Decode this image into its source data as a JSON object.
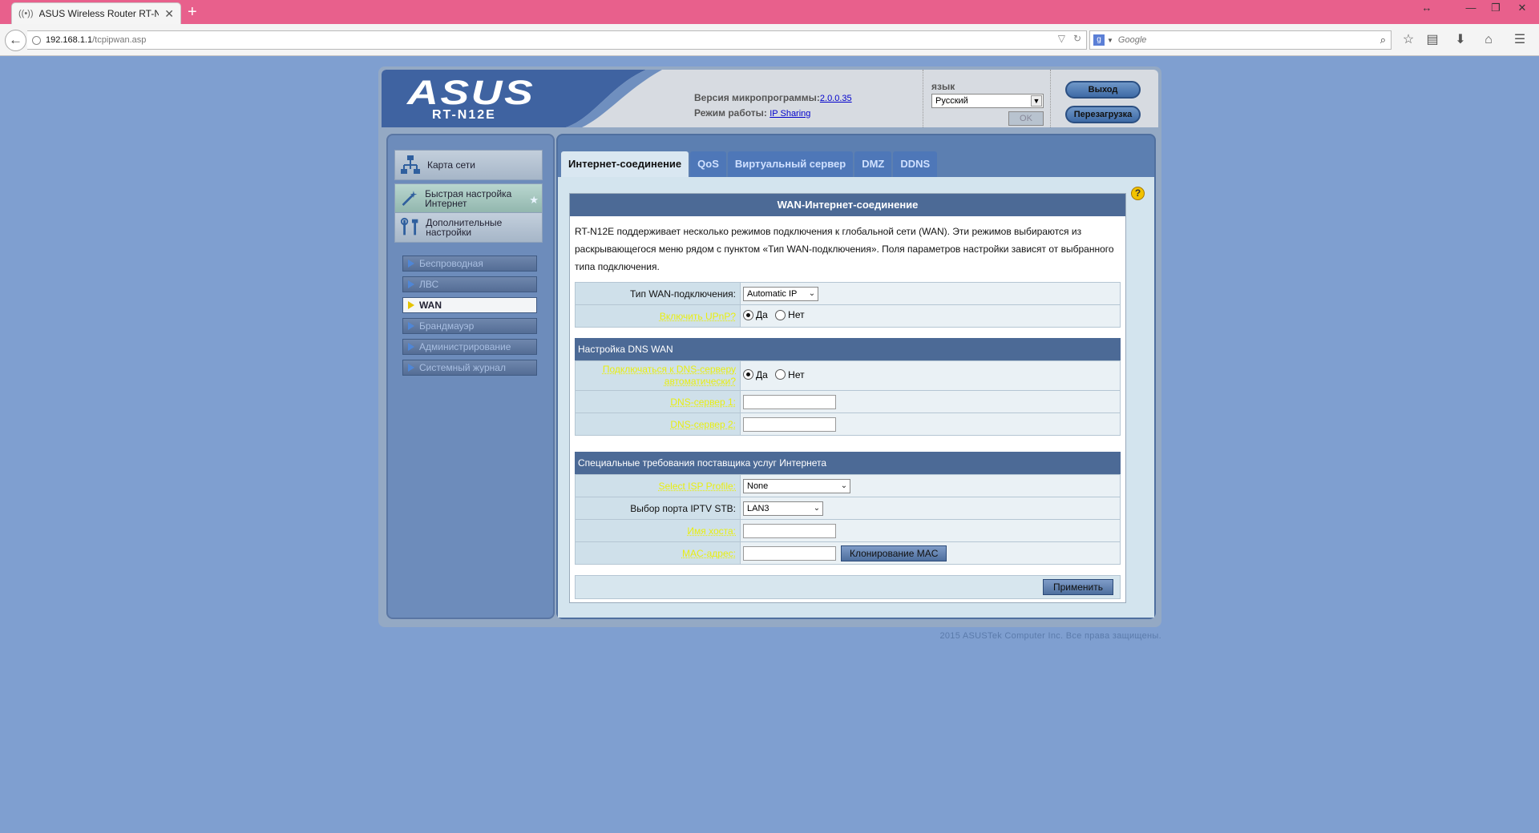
{
  "browser": {
    "tab_title": "ASUS Wireless Router RT-N...",
    "new_tab": "+",
    "url_host": "192.168.1.1",
    "url_path": "/tcpipwan.asp",
    "search_placeholder": "Google"
  },
  "header": {
    "logo": "ASUS",
    "model": "RT-N12E",
    "firmware_label": "Версия микропрограммы:",
    "firmware_version": "2.0.0.35",
    "mode_label": "Режим работы:",
    "mode_value": "IP Sharing",
    "language_label": "язык",
    "language_value": "Русский",
    "ok_label": "OK",
    "logout_label": "Выход",
    "reboot_label": "Перезагрузка"
  },
  "menu": {
    "network_map": "Карта сети",
    "quick_setup": "Быстрая настройка Интернет",
    "advanced": "Дополнительные настройки",
    "sub": [
      "Беспроводная",
      "ЛВС",
      "WAN",
      "Брандмауэр",
      "Администрирование",
      "Системный журнал"
    ]
  },
  "tabs": [
    "Интернет-соединение",
    "QoS",
    "Виртуальный сервер",
    "DMZ",
    "DDNS"
  ],
  "box": {
    "title": "WAN-Интернет-соединение",
    "description": "RT-N12E поддерживает несколько режимов подключения к глобальной сети (WAN). Эти режимов выбираются из раскрывающегося меню рядом с пунктом «Тип WAN-подключения». Поля параметров настройки зависят от выбранного типа подключения.",
    "wan_type_label": "Тип WAN-подключения:",
    "wan_type_value": "Automatic IP",
    "upnp_label": "Включить UPnP?",
    "yes": "Да",
    "no": "Нет",
    "dns_section": "Настройка DNS WAN",
    "dns_auto_label": "Подключаться к DNS-серверу автоматически?",
    "dns1_label": "DNS-сервер 1:",
    "dns2_label": "DNS-сервер 2:",
    "isp_section": "Специальные требования поставщика услуг Интернета",
    "isp_profile_label": "Select ISP Profile:",
    "isp_profile_value": "None",
    "iptv_label": "Выбор порта IPTV STB:",
    "iptv_value": "LAN3",
    "hostname_label": "Имя хоста:",
    "mac_label": "MAC-адрес:",
    "clone_mac": "Клонирование MAC",
    "apply": "Применить"
  },
  "footer": "2015 ASUSTek Computer Inc. Все права защищены."
}
